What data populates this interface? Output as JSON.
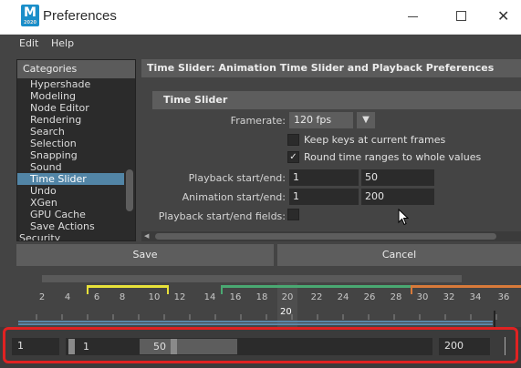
{
  "window": {
    "title": "Preferences",
    "app_icon_letter": "M",
    "app_icon_sub": "2020"
  },
  "menu": [
    "Edit",
    "Help"
  ],
  "categories": {
    "header": "Categories",
    "items": [
      "Hypershade",
      "Modeling",
      "Node Editor",
      "Rendering",
      "Search",
      "Selection",
      "Snapping",
      "Sound",
      "Time Slider",
      "Undo",
      "XGen",
      "GPU Cache",
      "Save Actions",
      "Security"
    ],
    "selected": "Time Slider"
  },
  "panel": {
    "header": "Time Slider: Animation Time Slider and Playback Preferences",
    "section": "Time Slider",
    "framerate_label": "Framerate:",
    "framerate_value": "120 fps",
    "keep_keys_label": "Keep keys at current frames",
    "keep_keys_checked": false,
    "round_time_label": "Round time ranges to whole values",
    "round_time_checked": true,
    "check_mark": "✓",
    "playback_label": "Playback start/end:",
    "playback_start": "1",
    "playback_end": "50",
    "animation_label": "Animation start/end:",
    "animation_start": "1",
    "animation_end": "200",
    "fields_label": "Playback start/end fields:"
  },
  "buttons": {
    "save": "Save",
    "cancel": "Cancel"
  },
  "timeline": {
    "frames": [
      "2",
      "4",
      "6",
      "8",
      "10",
      "12",
      "14",
      "16",
      "18",
      "20",
      "22",
      "24",
      "26",
      "28",
      "30",
      "32",
      "34",
      "36"
    ],
    "current_frame": "20"
  },
  "range_slider": {
    "anim_start": "1",
    "playback_start": "1",
    "playback_end": "50",
    "anim_end": "200"
  },
  "colors": {
    "selection": "#5285a6",
    "highlight_box": "#e02222",
    "bookmark_yellow": "#e8e23a",
    "bookmark_green": "#4aa872",
    "bookmark_orange": "#d87a3a"
  }
}
